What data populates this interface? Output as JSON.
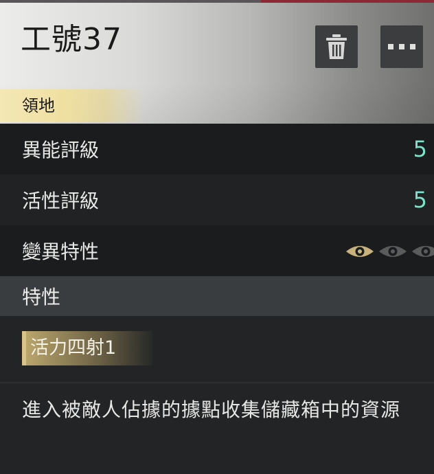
{
  "header": {
    "title": "工號37",
    "tag": "領地"
  },
  "actions": {
    "delete_icon": "trash-icon",
    "more_icon": "more-icon"
  },
  "stats": [
    {
      "label": "異能評級",
      "value": "5"
    },
    {
      "label": "活性評級",
      "value": "5"
    },
    {
      "label": "變異特性",
      "eyes": {
        "active": 1,
        "total": 3
      }
    }
  ],
  "traits": {
    "section_title": "特性",
    "items": [
      {
        "name": "活力四射1"
      }
    ],
    "description": "進入被敵人佔據的據點收集儲藏箱中的資源"
  },
  "colors": {
    "value_accent": "#7ee3c9",
    "gold": "#e9d68b",
    "eye_active": "#c6b27a",
    "eye_inactive": "#5a5c5c"
  }
}
